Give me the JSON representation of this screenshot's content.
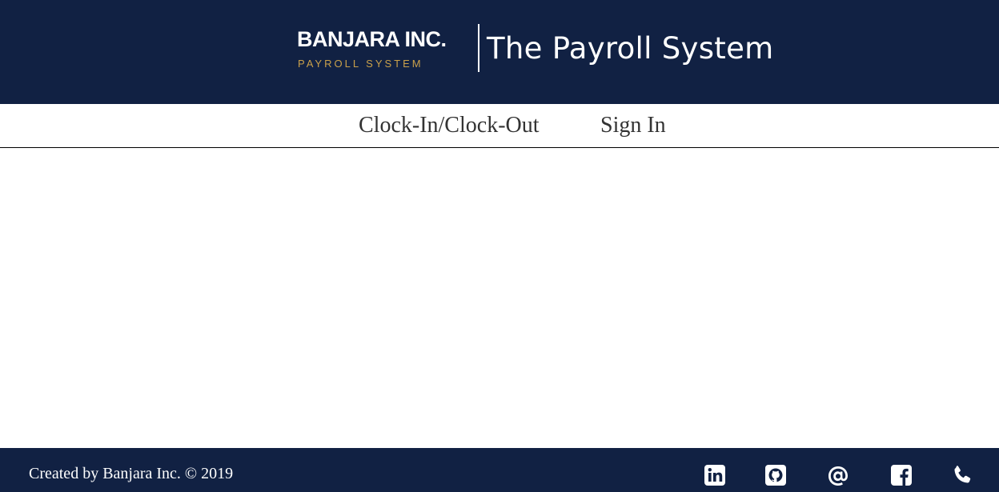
{
  "header": {
    "logo_name": "BANJARA INC.",
    "logo_subtitle": "PAYROLL SYSTEM",
    "title": "The Payroll System"
  },
  "nav": {
    "items": [
      {
        "label": "Clock-In/Clock-Out"
      },
      {
        "label": "Sign In"
      }
    ]
  },
  "footer": {
    "copyright": "Created by Banjara Inc. © 2019",
    "social_icons": [
      "linkedin-icon",
      "github-icon",
      "email-icon",
      "facebook-icon",
      "phone-icon"
    ]
  },
  "colors": {
    "brand_navy": "#112143",
    "logo_gold": "#c9a04a",
    "nav_text": "#333333"
  }
}
